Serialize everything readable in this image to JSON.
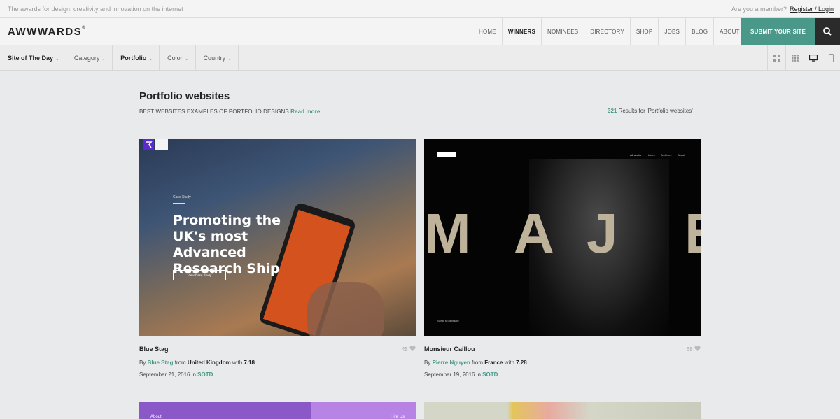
{
  "topbar": {
    "tagline": "The awards for design, creativity and innovation on the internet",
    "member_q": "Are you a member?",
    "login": "Register / Login"
  },
  "nav": {
    "logo": "AWWWARDS",
    "links": [
      "HOME",
      "WINNERS",
      "NOMINEES",
      "DIRECTORY",
      "SHOP",
      "JOBS",
      "BLOG",
      "ABOUT US"
    ],
    "active": "WINNERS",
    "submit": "SUBMIT YOUR SITE"
  },
  "filters": [
    "Site of The Day",
    "Category",
    "Portfolio",
    "Color",
    "Country"
  ],
  "page": {
    "title": "Portfolio websites",
    "subtitle": "BEST WEBSITES EXAMPLES OF PORTFOLIO DESIGNS",
    "read_more": "Read more",
    "results_count": "321",
    "results_text": "Results for 'Portfolio websites'"
  },
  "cards": [
    {
      "title": "Blue Stag",
      "likes": "45",
      "by": "Blue Stag",
      "country": "United Kingdom",
      "score": "7.18",
      "date": "September 21, 2016",
      "award": "SOTD",
      "shot": {
        "small": "Case Study",
        "headline": "Promoting the UK's most Advanced Research Ship",
        "button": "View Case Study"
      }
    },
    {
      "title": "Monsieur Caillou",
      "likes": "68",
      "by": "Pierre Nguyen",
      "country": "France",
      "score": "7.28",
      "date": "September 19, 2016",
      "award": "SOTD",
      "shot": {
        "nav": [
          "All works",
          "Index",
          "Archives",
          "About"
        ],
        "letters": [
          "M",
          "A",
          "J",
          "E"
        ],
        "scroll": "Scroll to navigate"
      }
    }
  ],
  "peek": {
    "left_a": "About",
    "left_b": "Hire Us"
  },
  "colors": {
    "accent": "#4a988a",
    "dark": "#2b2b2b"
  }
}
